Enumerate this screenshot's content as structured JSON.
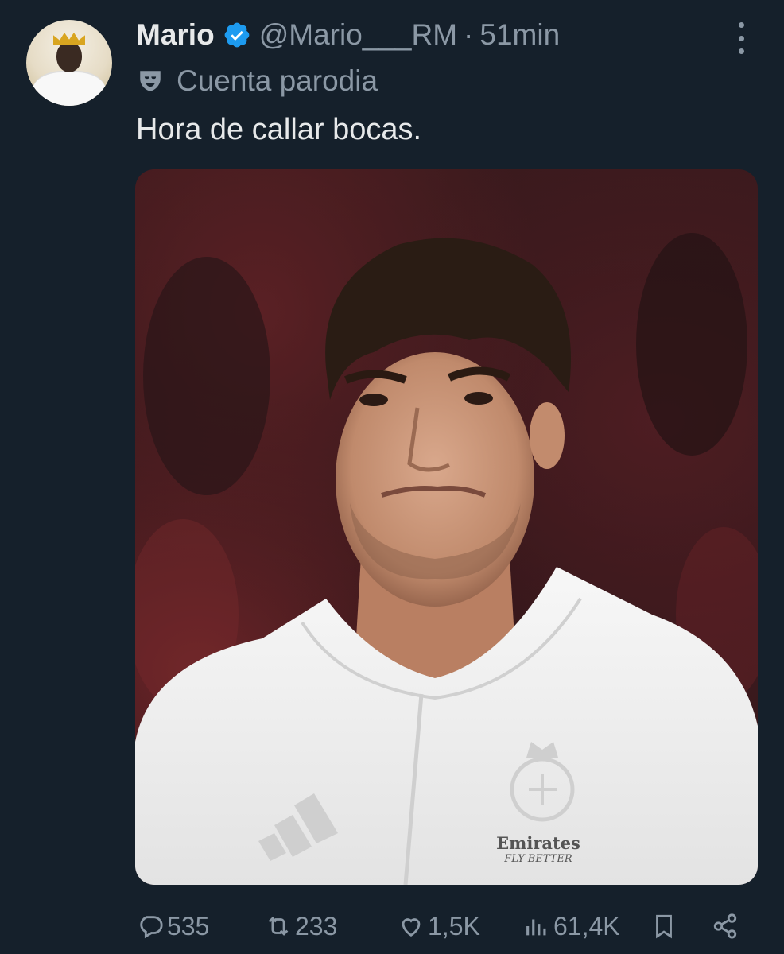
{
  "tweet": {
    "author_name": "Mario",
    "author_handle": "@Mario___RM",
    "separator": "·",
    "timestamp": "51min",
    "parody_label": "Cuenta parodia",
    "text": "Hora de callar bocas.",
    "verified_color": "#1d9bf0",
    "media": {
      "jersey_brand": "Emirates",
      "jersey_slogan": "FLY BETTER"
    }
  },
  "actions": {
    "replies": "535",
    "retweets": "233",
    "likes": "1,5K",
    "views": "61,4K"
  },
  "icons": {
    "more": "more-vertical-icon",
    "verified": "verified-badge-icon",
    "parody": "parody-mask-icon",
    "reply": "reply-icon",
    "retweet": "retweet-icon",
    "like": "heart-icon",
    "views": "views-chart-icon",
    "bookmark": "bookmark-icon",
    "share": "share-icon"
  }
}
